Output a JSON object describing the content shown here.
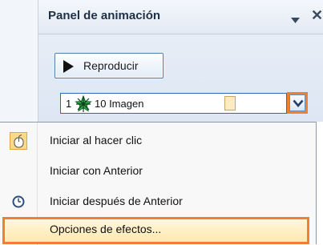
{
  "panel": {
    "title": "Panel de animación",
    "close_glyph": "✕",
    "dropdown_icon": "triangle-down-icon",
    "close_icon": "close-icon"
  },
  "play_button": {
    "label": "Reproducir",
    "icon": "play-icon"
  },
  "animation_item": {
    "number": "1",
    "effect_icon": "green-star-entrance-icon",
    "name": "10 Imagen",
    "dropdown_icon": "chevron-down-icon"
  },
  "menu": {
    "items": [
      {
        "label": "Iniciar al hacer clic",
        "icon": "mouse-icon",
        "checked": true
      },
      {
        "label": "Iniciar con Anterior",
        "icon": ""
      },
      {
        "label": "Iniciar después de Anterior",
        "icon": "clock-icon"
      },
      {
        "label": "Opciones de efectos...",
        "icon": "",
        "highlighted": true
      }
    ]
  },
  "colors": {
    "highlight_border": "#f08030",
    "panel_bg": "#e3eaf4",
    "selection_border": "#2e66b8"
  }
}
